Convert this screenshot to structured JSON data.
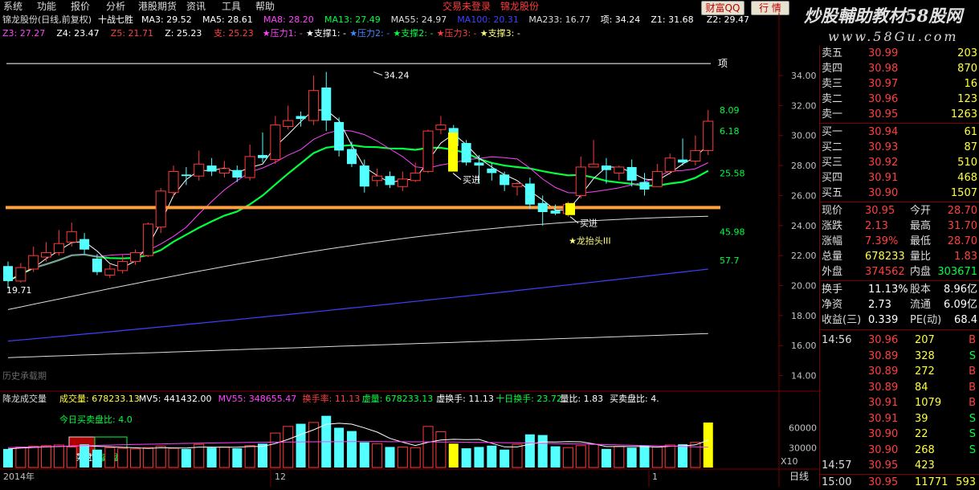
{
  "menu": [
    "系统",
    "功能",
    "报价",
    "分析",
    "港股期货",
    "资讯",
    "工具",
    "帮助"
  ],
  "status": {
    "login": "交易未登录",
    "stock": "锦龙股份"
  },
  "top_buttons": {
    "wealth": "财富QQ",
    "quote": "行 情"
  },
  "brand": {
    "title": "炒股輔助教材58股网",
    "url": "www.58Gu.com"
  },
  "chart_data": {
    "type": "candlestick",
    "title": "锦龙股份(日线,前复权)",
    "indicator": "十战七胜",
    "ma_labels": [
      {
        "text": "MA3: 29.52",
        "color": "#ffffff"
      },
      {
        "text": "MA5: 28.61",
        "color": "#ffffff"
      },
      {
        "text": "MA8: 28.20",
        "color": "#ff44ff"
      },
      {
        "text": "MA13: 27.49",
        "color": "#00ff40"
      },
      {
        "text": "MA55: 24.97",
        "color": "#dcdcdc"
      },
      {
        "text": "MA100: 20.31",
        "color": "#4040ff"
      },
      {
        "text": "MA233: 16.77",
        "color": "#dcdcdc"
      },
      {
        "text": "项: 34.24",
        "color": "#ffffff"
      },
      {
        "text": "Z1: 31.68",
        "color": "#ffffff"
      },
      {
        "text": "Z2: 29.47",
        "color": "#ffffff"
      }
    ],
    "row2_labels": [
      {
        "text": "Z3: 27.27",
        "color": "#ff44ff"
      },
      {
        "text": "Z4: 23.47",
        "color": "#ffffff"
      },
      {
        "text": "Z5: 21.71",
        "color": "#ff4040"
      },
      {
        "text": "Z: 25.23",
        "color": "#ffffff"
      },
      {
        "text": "支: 25.23",
        "color": "#ff4040"
      },
      {
        "text": "★压力1: -",
        "color": "#ff44ff"
      },
      {
        "text": "★支撑1: -",
        "color": "#ffffff"
      },
      {
        "text": "★压力2: -",
        "color": "#4488ff"
      },
      {
        "text": "★支撑2: -",
        "color": "#00ff40"
      },
      {
        "text": "★压力3: -",
        "color": "#ff4040"
      },
      {
        "text": "★支撑3: -",
        "color": "#ffff80"
      }
    ],
    "y_range": [
      12.8,
      35.5
    ],
    "y_ticks": [
      "34.00",
      "32.00",
      "30.00",
      "28.00",
      "26.00",
      "24.00",
      "22.00",
      "20.00",
      "18.00",
      "16.00",
      "14.00"
    ],
    "x_labels": [
      "2014年",
      "12",
      "1"
    ],
    "candles": [
      [
        21.3,
        20.3,
        21.6,
        19.8
      ],
      [
        20.3,
        21.2,
        21.5,
        20.2
      ],
      [
        21.1,
        22.0,
        22.6,
        20.9
      ],
      [
        21.9,
        22.2,
        22.9,
        21.6
      ],
      [
        22.2,
        22.8,
        23.7,
        22.0
      ],
      [
        22.9,
        23.6,
        24.2,
        22.6
      ],
      [
        23.1,
        22.4,
        23.5,
        22.1
      ],
      [
        21.8,
        20.9,
        22.1,
        20.7
      ],
      [
        20.7,
        21.1,
        21.4,
        20.5
      ],
      [
        21.0,
        21.6,
        22.1,
        20.8
      ],
      [
        21.6,
        22.2,
        22.4,
        21.4
      ],
      [
        22.0,
        24.1,
        24.2,
        21.9
      ],
      [
        23.9,
        26.3,
        26.5,
        23.5
      ],
      [
        26.2,
        27.6,
        28.0,
        25.9
      ],
      [
        27.4,
        27.3,
        27.9,
        26.7
      ],
      [
        27.3,
        28.1,
        29.0,
        27.0
      ],
      [
        28.0,
        27.6,
        28.5,
        27.3
      ],
      [
        27.5,
        27.8,
        28.3,
        27.2
      ],
      [
        27.7,
        27.2,
        28.0,
        26.9
      ],
      [
        27.2,
        28.6,
        29.4,
        27.0
      ],
      [
        28.7,
        28.5,
        30.2,
        28.2
      ],
      [
        28.4,
        30.7,
        31.3,
        28.1
      ],
      [
        30.6,
        31.0,
        32.0,
        30.4
      ],
      [
        31.3,
        31.1,
        31.6,
        30.6
      ],
      [
        31.0,
        33.0,
        34.0,
        30.7
      ],
      [
        33.2,
        31.0,
        34.24,
        30.3
      ],
      [
        30.9,
        29.0,
        31.2,
        28.6
      ],
      [
        29.1,
        28.1,
        29.6,
        27.9
      ],
      [
        28.0,
        26.6,
        28.4,
        26.2
      ],
      [
        27.0,
        27.3,
        27.8,
        26.6
      ],
      [
        27.3,
        26.7,
        27.6,
        26.5
      ],
      [
        26.6,
        27.1,
        27.6,
        26.3
      ],
      [
        27.0,
        27.5,
        28.2,
        26.9
      ],
      [
        27.6,
        30.3,
        30.4,
        27.5
      ],
      [
        30.4,
        30.7,
        31.3,
        30.1
      ],
      [
        30.5,
        29.3,
        30.7,
        28.9
      ],
      [
        29.5,
        28.2,
        29.7,
        28.0
      ],
      [
        28.2,
        28.0,
        28.7,
        26.8
      ],
      [
        27.8,
        27.5,
        28.2,
        27.0
      ],
      [
        27.4,
        26.7,
        27.6,
        26.3
      ],
      [
        26.6,
        26.8,
        26.9,
        26.0
      ],
      [
        26.8,
        25.4,
        27.2,
        25.1
      ],
      [
        25.5,
        24.9,
        26.0,
        24.0
      ],
      [
        25.0,
        24.8,
        25.4,
        24.7
      ],
      [
        24.8,
        25.4,
        25.6,
        24.6
      ],
      [
        26.0,
        27.9,
        28.6,
        25.8
      ],
      [
        27.9,
        28.1,
        29.7,
        27.9
      ],
      [
        28.0,
        27.7,
        28.5,
        26.8
      ],
      [
        27.5,
        27.9,
        28.0,
        27.0
      ],
      [
        27.9,
        27.0,
        28.4,
        26.6
      ],
      [
        26.9,
        26.4,
        27.5,
        26.0
      ],
      [
        26.6,
        27.6,
        28.1,
        26.6
      ],
      [
        27.6,
        28.5,
        28.8,
        27.4
      ],
      [
        28.4,
        28.2,
        29.8,
        28.0
      ],
      [
        28.3,
        29.0,
        30.0,
        28.0
      ],
      [
        29.0,
        30.95,
        31.7,
        28.7
      ]
    ],
    "buy_signal_days": [
      27,
      38
    ],
    "right_labels": [
      {
        "text": "8.09",
        "price": 31.7
      },
      {
        "text": "6.18",
        "price": 30.3
      },
      {
        "text": "25.58",
        "price": 27.5
      },
      {
        "text": "45.98",
        "price": 23.6
      },
      {
        "text": "57.7",
        "price": 21.7
      }
    ],
    "annotations": {
      "peak": "34.24",
      "low": "19.71",
      "top_line": "项",
      "buy": "买进",
      "dragon": "★龙抬头III",
      "watermark": "历史承载期"
    },
    "support_price": 25.2,
    "top_line_price": 34.8,
    "volume": {
      "title": "降龙成交量",
      "labels": [
        {
          "text": "成交量: 678233.13",
          "color": "#ffff40"
        },
        {
          "text": "MV5: 441432.00",
          "color": "#ffffff"
        },
        {
          "text": "MV55: 348655.47",
          "color": "#ff44ff"
        },
        {
          "text": "换手率: 11.13",
          "color": "#ff4040"
        },
        {
          "text": "虚量: 678233.13",
          "color": "#00ff40"
        },
        {
          "text": "虚换手: 11.13",
          "color": "#ffffff"
        },
        {
          "text": "十日换手: 23.72",
          "color": "#00ff40"
        },
        {
          "text": "量比: 1.83",
          "color": "#ffffff"
        },
        {
          "text": "买卖盘比: 4.",
          "color": "#ffffff"
        }
      ],
      "today_ratio": "今日买卖盘比: 4.0",
      "buy_box": "买盘",
      "sell_box": "卖盘",
      "y_ticks": [
        "60000",
        "30000"
      ],
      "y_multiplier": "X10",
      "y_range": [
        0,
        80000
      ],
      "values": [
        28000,
        31000,
        32000,
        33000,
        34000,
        31000,
        35000,
        27000,
        30000,
        29000,
        28000,
        30000,
        32000,
        29000,
        28000,
        35000,
        30000,
        31000,
        29000,
        33000,
        36000,
        52000,
        62000,
        66000,
        68000,
        78000,
        60000,
        55000,
        38000,
        36000,
        31000,
        31000,
        30000,
        62000,
        54000,
        36000,
        29000,
        31000,
        33000,
        27000,
        35000,
        50000,
        49000,
        32000,
        30000,
        33000,
        35000,
        28000,
        32000,
        30000,
        33000,
        31000,
        34000,
        35000,
        38000,
        67823
      ]
    }
  },
  "rightpanel": {
    "asks": [
      {
        "label": "卖五",
        "price": "30.99",
        "vol": "203"
      },
      {
        "label": "卖四",
        "price": "30.98",
        "vol": "870"
      },
      {
        "label": "卖三",
        "price": "30.97",
        "vol": "16"
      },
      {
        "label": "卖二",
        "price": "30.96",
        "vol": "123"
      },
      {
        "label": "卖一",
        "price": "30.95",
        "vol": "1263"
      }
    ],
    "bids": [
      {
        "label": "买一",
        "price": "30.94",
        "vol": "61"
      },
      {
        "label": "买二",
        "price": "30.93",
        "vol": "87"
      },
      {
        "label": "买三",
        "price": "30.92",
        "vol": "510"
      },
      {
        "label": "买四",
        "price": "30.91",
        "vol": "468"
      },
      {
        "label": "买五",
        "price": "30.90",
        "vol": "1507"
      }
    ],
    "stats": [
      {
        "l1": "现价",
        "v1": "30.95",
        "c1": "#ff4040",
        "l2": "今开",
        "v2": "28.70",
        "c2": "#ff4040"
      },
      {
        "l1": "涨跌",
        "v1": "2.13",
        "c1": "#ff4040",
        "l2": "最高",
        "v2": "31.70",
        "c2": "#ff4040"
      },
      {
        "l1": "涨幅",
        "v1": "7.39%",
        "c1": "#ff4040",
        "l2": "最低",
        "v2": "28.70",
        "c2": "#ff4040"
      },
      {
        "l1": "总量",
        "v1": "678233",
        "c1": "#ffff40",
        "l2": "量比",
        "v2": "1.83",
        "c2": "#ff4040"
      },
      {
        "l1": "外盘",
        "v1": "374562",
        "c1": "#ff4040",
        "l2": "内盘",
        "v2": "303671",
        "c2": "#00ff40"
      }
    ],
    "stats2": [
      {
        "l1": "换手",
        "v1": "11.13%",
        "l2": "股本",
        "v2": "8.96亿"
      },
      {
        "l1": "净资",
        "v1": "2.73",
        "l2": "流通",
        "v2": "6.09亿"
      },
      {
        "l1": "收益(三)",
        "v1": "0.339",
        "l2": "PE(动)",
        "v2": "68.4"
      }
    ],
    "ticks": [
      {
        "time": "14:56",
        "price": "30.96",
        "vol": "207",
        "bs": "B"
      },
      {
        "time": "",
        "price": "30.89",
        "vol": "328",
        "bs": "S"
      },
      {
        "time": "",
        "price": "30.89",
        "vol": "272",
        "bs": "B"
      },
      {
        "time": "",
        "price": "30.89",
        "vol": "84",
        "bs": "B"
      },
      {
        "time": "",
        "price": "30.91",
        "vol": "1079",
        "bs": "B"
      },
      {
        "time": "",
        "price": "30.91",
        "vol": "39",
        "bs": "S"
      },
      {
        "time": "",
        "price": "30.90",
        "vol": "22",
        "bs": "S"
      },
      {
        "time": "",
        "price": "30.90",
        "vol": "268",
        "bs": "S"
      },
      {
        "time": "14:57",
        "price": "30.95",
        "vol": "423",
        "bs": ""
      },
      {
        "time": "15:00",
        "price": "30.95",
        "vol": "11771",
        "bs": "593"
      }
    ]
  },
  "bottom": {
    "period": "日线"
  },
  "colors": {
    "up": "#ff3a3a",
    "down": "#54ffff",
    "ma3": "#ffffff",
    "ma8": "#ff44ff",
    "ma13": "#00ff40",
    "ma55": "#dcdcdc",
    "ma100": "#4040ff",
    "ma233": "#dcdcdc",
    "support": "#ffa040",
    "buy": "#ffff00"
  }
}
